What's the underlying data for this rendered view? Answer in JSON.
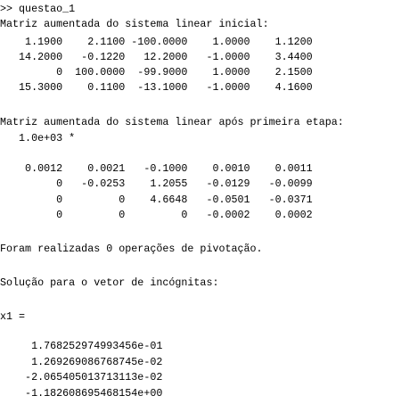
{
  "console": {
    "prompt_line": ">> questao_1",
    "matrix1_title": "Matriz aumentada do sistema linear inicial:",
    "matrix1_rows": [
      "    1.1900    2.1100 -100.0000    1.0000    1.1200",
      "   14.2000   -0.1220   12.2000   -1.0000    3.4400",
      "         0  100.0000  -99.9000    1.0000    2.1500",
      "   15.3000    0.1100  -13.1000   -1.0000    4.1600"
    ],
    "matrix2_title": "Matriz aumentada do sistema linear após primeira etapa:",
    "matrix2_scale": "   1.0e+03 *",
    "matrix2_rows": [
      "    0.0012    0.0021   -0.1000    0.0010    0.0011",
      "         0   -0.0253    1.2055   -0.0129   -0.0099",
      "         0         0    4.6648   -0.0501   -0.0371",
      "         0         0         0   -0.0002    0.0002"
    ],
    "pivot_message": "Foram realizadas 0 operações de pivotação.",
    "solution_title": "Solução para o vetor de incógnitas:",
    "var_assign": "x1 =",
    "solution_values": [
      "     1.768252974993456e-01",
      "     1.269269086768745e-02",
      "    -2.065405013713113e-02",
      "    -1.182608695468154e+00"
    ]
  }
}
